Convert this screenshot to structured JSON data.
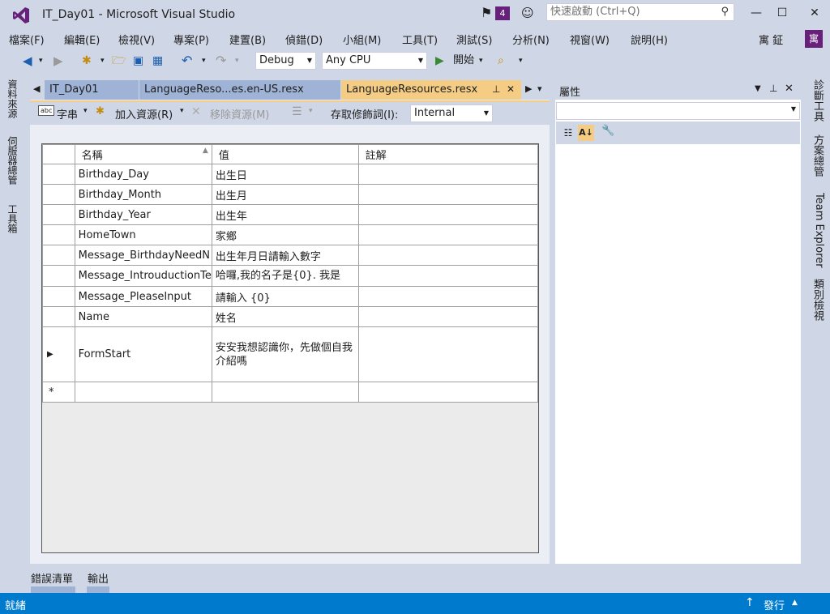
{
  "titlebar": {
    "title": "IT_Day01 - Microsoft Visual Studio",
    "notif_count": "4",
    "quick_launch_placeholder": "快速啟動 (Ctrl+Q)"
  },
  "menu": {
    "items": [
      "檔案(F)",
      "編輯(E)",
      "檢視(V)",
      "專案(P)",
      "建置(B)",
      "偵錯(D)",
      "小組(M)",
      "工具(T)",
      "測試(S)",
      "分析(N)",
      "視窗(W)",
      "說明(H)"
    ],
    "user": "寓 鉦",
    "avatar": "寓"
  },
  "toolbar": {
    "config": "Debug",
    "platform": "Any CPU",
    "start_label": "開始"
  },
  "left_dock": [
    "資料來源",
    "伺服器總管",
    "工具箱"
  ],
  "right_dock": [
    "診斷工具",
    "方案總管",
    "Team Explorer",
    "類別檢視"
  ],
  "tabs": [
    "IT_Day01",
    "LanguageReso...es.en-US.resx",
    "LanguageResources.resx"
  ],
  "resource_toolbar": {
    "strings_label": "字串",
    "add_label": "加入資源(R)",
    "remove_label": "移除資源(M)",
    "access_label": "存取修飾詞(I):",
    "access_value": "Internal"
  },
  "grid": {
    "headers": [
      "名稱",
      "值",
      "註解"
    ],
    "rows": [
      {
        "name": "Birthday_Day",
        "value": "出生日",
        "comment": ""
      },
      {
        "name": "Birthday_Month",
        "value": "出生月",
        "comment": ""
      },
      {
        "name": "Birthday_Year",
        "value": "出生年",
        "comment": ""
      },
      {
        "name": "HomeTown",
        "value": "家鄉",
        "comment": ""
      },
      {
        "name": "Message_BirthdayNeedN",
        "value": "出生年月日請輸入數字",
        "comment": ""
      },
      {
        "name": "Message_IntrouductionTe",
        "value": "哈囉,我的名子是{0}. 我是",
        "comment": ""
      },
      {
        "name": "Message_PleaseInput",
        "value": "請輸入 {0}",
        "comment": ""
      },
      {
        "name": "Name",
        "value": "姓名",
        "comment": ""
      },
      {
        "name": "FormStart",
        "value": "安安我想認識你，先做個自我介紹嗎",
        "comment": ""
      }
    ]
  },
  "properties": {
    "title": "屬性"
  },
  "bottom_tabs": [
    "錯誤清單",
    "輸出"
  ],
  "status": {
    "text": "就緒",
    "publish": "發行"
  },
  "colors": {
    "accent": "#68217a",
    "status_bar": "#007acc",
    "active_tab": "#f5cc84"
  }
}
